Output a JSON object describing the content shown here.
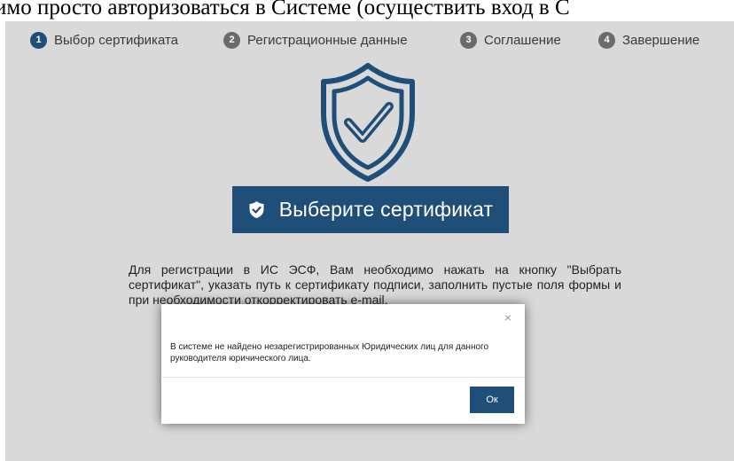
{
  "document": {
    "top_text": "имо просто авторизоваться в Системе (осуществить вход в С"
  },
  "steps": [
    {
      "number": "1",
      "label": "Выбор сертификата",
      "active": true
    },
    {
      "number": "2",
      "label": "Регистрационные данные",
      "active": false
    },
    {
      "number": "3",
      "label": "Соглашение",
      "active": false
    },
    {
      "number": "4",
      "label": "Завершение",
      "active": false
    }
  ],
  "main": {
    "select_certificate_button": "Выберите сертификат",
    "description": "Для регистрации в ИС ЭСФ, Вам необходимо нажать на кнопку \"Выбрать сертификат\", указать путь к сертификату подписи, заполнить пустые поля формы и при необходимости откорректировать e-mail."
  },
  "modal": {
    "close_symbol": "×",
    "message": "В системе не найдено незарегистрированных Юридических лиц для данного руководителя юричического лица.",
    "ok_label": "Ок"
  },
  "icons": {
    "shield": "shield-check-icon",
    "button": "shield-check-small-icon"
  },
  "colors": {
    "primary": "#1f4e79",
    "background": "#d9d9d9",
    "step_inactive": "#6b6b6b"
  }
}
